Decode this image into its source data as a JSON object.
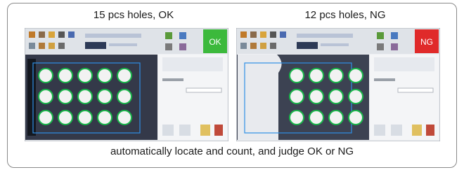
{
  "panels": [
    {
      "title": "15 pcs holes, OK",
      "status_label": "OK",
      "status_color": "#3cb93c",
      "hole_count": 15
    },
    {
      "title": "12 pcs holes, NG",
      "status_label": "NG",
      "status_color": "#e02a2a",
      "hole_count": 12
    }
  ],
  "caption": "automatically locate and count, and judge OK or NG",
  "colors": {
    "border": "#8a8a8a",
    "hole_outline": "#19b84a",
    "roi_box": "#2f8fe6",
    "toolbar": "#d8dde4"
  },
  "toolbar_icons": [
    "open-icon",
    "camera-icon",
    "folder-icon",
    "print-icon",
    "settings-icon",
    "grid-icon",
    "chart-icon",
    "user-icon",
    "exit-icon"
  ]
}
